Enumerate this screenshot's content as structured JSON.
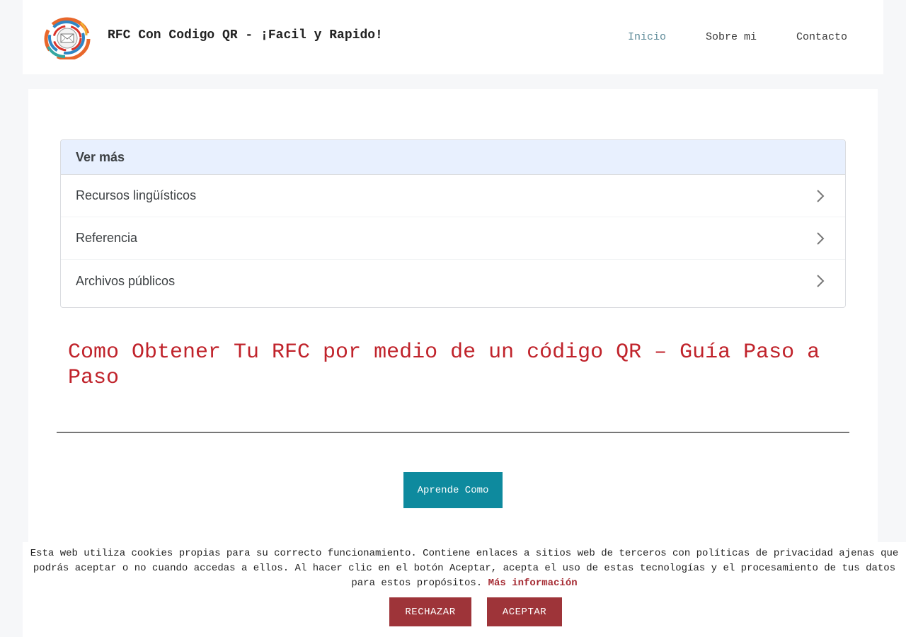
{
  "header": {
    "site_title": "RFC Con Codigo QR - ¡Facil y Rapido!",
    "nav": [
      {
        "label": "Inicio",
        "active": true
      },
      {
        "label": "Sobre mi",
        "active": false
      },
      {
        "label": "Contacto",
        "active": false
      }
    ]
  },
  "see_more": {
    "heading": "Ver más",
    "items": [
      {
        "label": "Recursos lingüísticos"
      },
      {
        "label": "Referencia"
      },
      {
        "label": "Archivos públicos"
      }
    ]
  },
  "article": {
    "title": "Como Obtener Tu RFC por medio de un código QR – Guía Paso a Paso",
    "cta_label": "Aprende Como"
  },
  "cookie_banner": {
    "text": "Esta web utiliza cookies propias para su correcto funcionamiento. Contiene enlaces a sitios web de terceros con políticas de privacidad ajenas que podrás aceptar o no cuando accedas a ellos. Al hacer clic en el botón Aceptar, acepta el uso de estas tecnologías y el procesamiento de tus datos para estos propósitos.",
    "more_info_label": "Más información",
    "reject_label": "RECHAZAR",
    "accept_label": "ACEPTAR"
  },
  "colors": {
    "accent_title": "#c0232b",
    "cta_background": "#0e8a9e",
    "cookie_button": "#9e3439",
    "nav_active": "#5d8a98",
    "see_more_header": "#e8f0fe"
  },
  "icons": {
    "logo": "envelope-swirl-logo-icon",
    "chevron": "chevron-right-icon"
  }
}
